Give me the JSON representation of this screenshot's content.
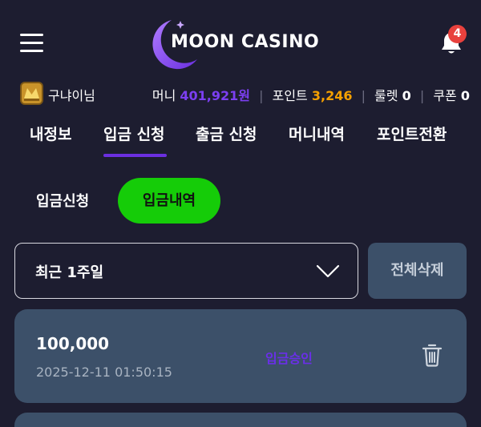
{
  "header": {
    "logo_text": "MOON CASINO",
    "notification_count": "4"
  },
  "user": {
    "name": "구냐이님",
    "money_label": "머니",
    "money_value": "401,921원",
    "point_label": "포인트",
    "point_value": "3,246",
    "roulette_label": "룰렛",
    "roulette_value": "0",
    "coupon_label": "쿠폰",
    "coupon_value": "0"
  },
  "tabs": [
    {
      "label": "내정보"
    },
    {
      "label": "입금 신청"
    },
    {
      "label": "출금 신청"
    },
    {
      "label": "머니내역"
    },
    {
      "label": "포인트전환"
    }
  ],
  "active_tab": "입금 신청",
  "subtabs": {
    "request_label": "입금신청",
    "history_label": "입금내역"
  },
  "filter": {
    "selected": "최근 1주일",
    "delete_all_label": "전체삭제"
  },
  "records": [
    {
      "amount": "100,000",
      "date": "2025-12-11 01:50:15",
      "status": "입금승인"
    }
  ],
  "colors": {
    "background": "#1d1d30",
    "accent_purple": "#7c3ff2",
    "accent_green": "#15cc08",
    "point_orange": "#f5a000",
    "card": "#3c5069",
    "badge_red": "#e8413d"
  },
  "icons": {
    "menu": "hamburger-menu-icon",
    "bell": "bell-icon",
    "chevron": "chevron-down-icon",
    "trash": "trash-icon",
    "avatar": "gold-avatar-badge"
  }
}
